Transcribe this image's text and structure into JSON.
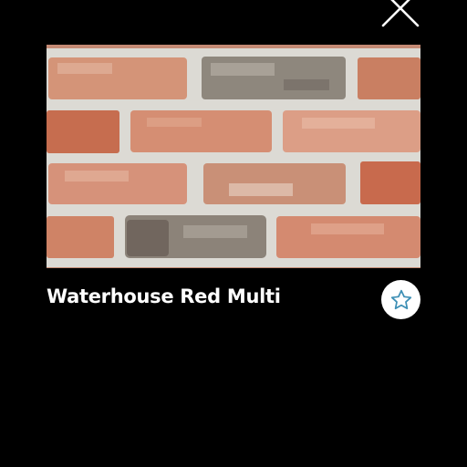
{
  "product": {
    "name": "Waterhouse Red Multi"
  },
  "icons": {
    "close": "close-icon",
    "favorite": "star-outline-icon"
  },
  "colors": {
    "background": "#000000",
    "title_text": "#ffffff",
    "favorite_button_bg": "#ffffff",
    "star_outline": "#3d8fb5"
  }
}
